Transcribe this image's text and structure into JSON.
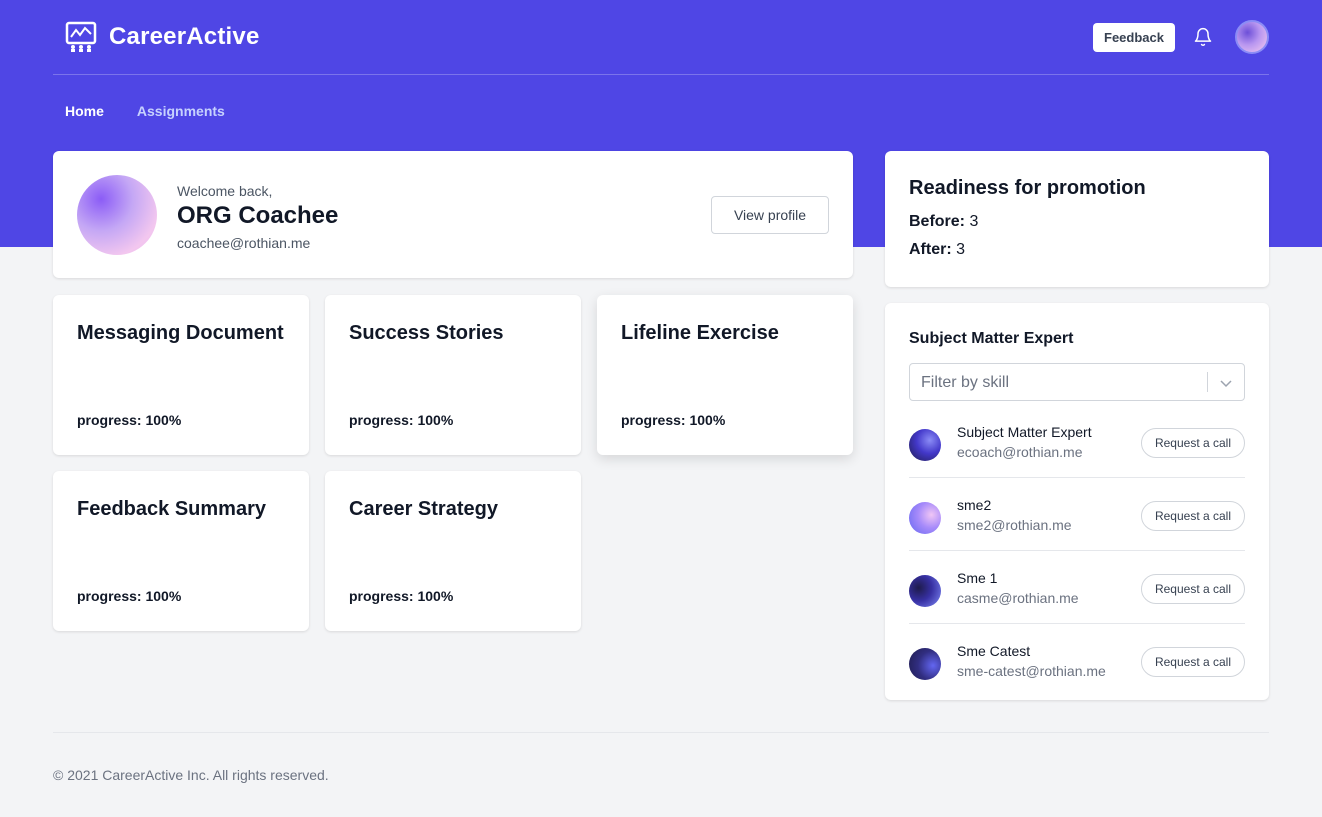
{
  "header": {
    "brand": "CareerActive",
    "feedback_label": "Feedback"
  },
  "nav": {
    "items": [
      {
        "label": "Home",
        "active": true
      },
      {
        "label": "Assignments",
        "active": false
      }
    ]
  },
  "welcome": {
    "greeting": "Welcome back,",
    "name": "ORG Coachee",
    "email": "coachee@rothian.me",
    "view_profile_label": "View profile"
  },
  "tasks": [
    {
      "title": "Messaging Document",
      "progress": "progress: 100%"
    },
    {
      "title": "Success Stories",
      "progress": "progress: 100%"
    },
    {
      "title": "Lifeline Exercise",
      "progress": "progress: 100%"
    },
    {
      "title": "Feedback Summary",
      "progress": "progress: 100%"
    },
    {
      "title": "Career Strategy",
      "progress": "progress: 100%"
    }
  ],
  "readiness": {
    "title": "Readiness for promotion",
    "before_label": "Before:",
    "before_value": "3",
    "after_label": "After:",
    "after_value": "3"
  },
  "sme": {
    "title": "Subject Matter Expert",
    "filter_placeholder": "Filter by skill",
    "request_label": "Request a call",
    "experts": [
      {
        "name": "Subject Matter Expert",
        "email": "ecoach@rothian.me"
      },
      {
        "name": "sme2",
        "email": "sme2@rothian.me"
      },
      {
        "name": "Sme 1",
        "email": "casme@rothian.me"
      },
      {
        "name": "Sme Catest",
        "email": "sme-catest@rothian.me"
      }
    ]
  },
  "footer": {
    "copyright": "© 2021 CareerActive Inc. All rights reserved."
  },
  "colors": {
    "brand": "#4f46e5",
    "page_bg": "#f3f4f6",
    "nav_inactive": "#c7d2fe"
  }
}
